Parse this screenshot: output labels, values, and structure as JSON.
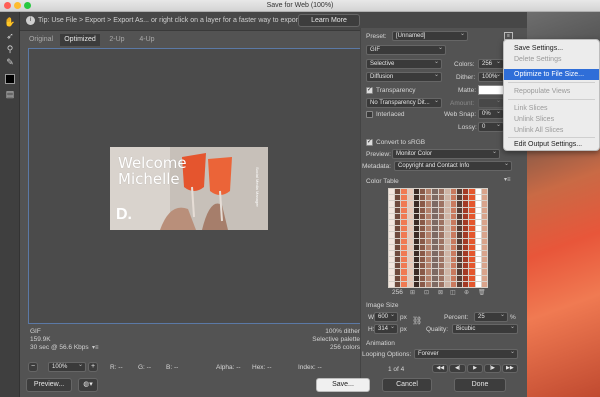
{
  "window": {
    "title": "Save for Web (100%)"
  },
  "tip": {
    "text": "Tip: Use File > Export > Export As... or right click on a layer for a faster way to export assets",
    "button": "Learn More"
  },
  "tabs": [
    "Original",
    "Optimized",
    "2-Up",
    "4-Up"
  ],
  "image": {
    "headline_line1": "Welcome",
    "headline_line2": "Michelle",
    "logo_letter": "D.",
    "side_text": "Social Media Manager"
  },
  "info_left": {
    "format": "GIF",
    "size": "159.9K",
    "speed": "30 sec @ 56.6 Kbps"
  },
  "info_right": {
    "dither": "100% dither",
    "palette": "Selective palette",
    "colors": "256 colors"
  },
  "status": {
    "zoom": "100%",
    "r": "R: --",
    "g": "G: --",
    "b": "B: --",
    "alpha": "Alpha: --",
    "hex": "Hex: --",
    "index": "Index: --"
  },
  "bottom": {
    "preview": "Preview...",
    "save": "Save...",
    "cancel": "Cancel",
    "done": "Done"
  },
  "settings": {
    "preset_label": "Preset:",
    "preset_value": "[Unnamed]",
    "format": "GIF",
    "reduction": "Selective",
    "dither_algo": "Diffusion",
    "colors_label": "Colors:",
    "colors_value": "256",
    "dither_label": "Dither:",
    "dither_value": "100%",
    "transparency_label": "Transparency",
    "matte_label": "Matte:",
    "transparency_dither": "No Transparency Dit...",
    "amount_label": "Amount:",
    "interlaced_label": "Interlaced",
    "websnap_label": "Web Snap:",
    "websnap_value": "0%",
    "lossy_label": "Lossy:",
    "lossy_value": "0",
    "convert_srgb": "Convert to sRGB",
    "preview_label": "Preview:",
    "preview_value": "Monitor Color",
    "metadata_label": "Metadata:",
    "metadata_value": "Copyright and Contact Info",
    "color_table_label": "Color Table",
    "color_count": "256"
  },
  "image_size": {
    "title": "Image Size",
    "w_label": "W:",
    "w_value": "600",
    "h_label": "H:",
    "h_value": "314",
    "unit": "px",
    "percent_label": "Percent:",
    "percent_value": "25",
    "percent_unit": "%",
    "quality_label": "Quality:",
    "quality_value": "Bicubic"
  },
  "animation": {
    "title": "Animation",
    "looping_label": "Looping Options:",
    "looping_value": "Forever",
    "frame": "1 of 4"
  },
  "menu": {
    "items": [
      {
        "label": "Save Settings...",
        "state": "normal"
      },
      {
        "label": "Delete Settings",
        "state": "disabled"
      },
      {
        "label": "Optimize to File Size...",
        "state": "highlight"
      },
      {
        "label": "Repopulate Views",
        "state": "disabled"
      },
      {
        "label": "Link Slices",
        "state": "disabled"
      },
      {
        "label": "Unlink Slices",
        "state": "disabled"
      },
      {
        "label": "Unlink All Slices",
        "state": "disabled"
      },
      {
        "label": "Edit Output Settings...",
        "state": "normal"
      }
    ]
  },
  "colors": {
    "accent": "#2f6ed8",
    "panel": "#535353",
    "photo_orange": "#e8563a"
  }
}
